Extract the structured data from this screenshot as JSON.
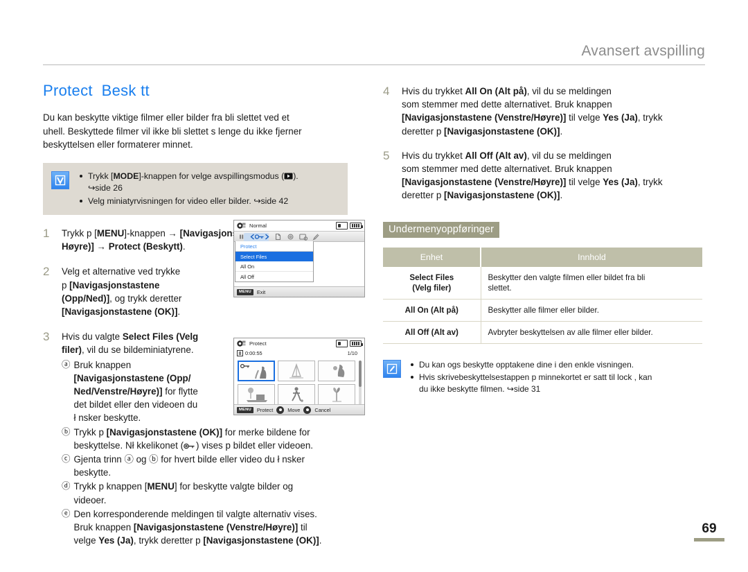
{
  "header": {
    "title": "Avansert avspilling"
  },
  "page": {
    "number": "69"
  },
  "left": {
    "section_title": "Protect  Besk tt",
    "intro": "Du kan beskytte viktige filmer eller bilder fra   bli slettet ved et\nuhell. Beskyttede filmer vil ikke bli slettet s   lenge du ikke fjerner\nbeskyttelsen eller formaterer minnet.",
    "tip_icon": "check-icon",
    "tips": [
      "Trykk [MODE]-knappen for   velge avspillingsmodus (  ).\n↪side 26",
      "Velg miniatyrvisningen for video eller bilder. ↪side 42"
    ],
    "tip1_a": "Trykk [",
    "tip1_mode": "MODE",
    "tip1_b": "]-knappen for   velge avspillingsmodus (",
    "tip1_c": ").",
    "tip1_page": "↪side 26",
    "tip2": "Velg miniatyrvisningen for video eller bilder. ",
    "tip2_page": "↪side 42",
    "steps": [
      {
        "num": "1",
        "parts": [
          {
            "t": "Trykk p  [",
            "b": false
          },
          {
            "t": "MENU",
            "b": true
          },
          {
            "t": "]-knappen → ",
            "b": false
          },
          {
            "t": "[Navigasjonstastene (Venstre/\nHøyre)]",
            "b": true
          },
          {
            "t": " → ",
            "b": false
          },
          {
            "t": "Protect (Beskytt)",
            "b": true
          },
          {
            "t": ".",
            "b": false
          }
        ]
      },
      {
        "num": "2",
        "parts": [
          {
            "t": "Velg et alternative ved   trykke\np  ",
            "b": false
          },
          {
            "t": "[Navigasjonstastene\n(Opp/Ned)]",
            "b": true
          },
          {
            "t": ", og trykk deretter\n",
            "b": false
          },
          {
            "t": "[Navigasjonstastene (OK)]",
            "b": true
          },
          {
            "t": ".",
            "b": false
          }
        ]
      },
      {
        "num": "3",
        "parts": [
          {
            "t": "Hvis du valgte ",
            "b": false
          },
          {
            "t": "Select Files (Velg\nfiler)",
            "b": true
          },
          {
            "t": ", vil du se bildeminiatyrene.",
            "b": false
          }
        ]
      }
    ],
    "substeps": [
      {
        "mark": "ⓐ",
        "parts": [
          {
            "t": "Bruk knappen\n",
            "b": false
          },
          {
            "t": "[Navigasjonstastene (Opp/\nNed/Venstre/Høyre)]",
            "b": true
          },
          {
            "t": " for   flytte\ndet bildet eller den videoen du\nł nsker   beskytte.",
            "b": false
          }
        ]
      },
      {
        "mark": "ⓑ",
        "parts": [
          {
            "t": "Trykk p  ",
            "b": false
          },
          {
            "t": "[Navigasjonstastene (OK)]",
            "b": true
          },
          {
            "t": " for   merke bildene for\nbeskyttelse. Nł kkelikonet (",
            "b": false
          },
          {
            "t": "KEYICON",
            "b": false
          },
          {
            "t": ") vises p   bildet eller videoen.",
            "b": false
          }
        ]
      },
      {
        "mark": "ⓒ",
        "parts": [
          {
            "t": "Gjenta trinn ⓐ og ⓑ for hvert bilde eller video du ł nsker\nbeskytte.",
            "b": false
          }
        ]
      },
      {
        "mark": "ⓓ",
        "parts": [
          {
            "t": "Trykk p   knappen [",
            "b": false
          },
          {
            "t": "MENU",
            "b": true
          },
          {
            "t": "] for   beskytte valgte bilder og\nvideoer.",
            "b": false
          }
        ]
      },
      {
        "mark": "ⓔ",
        "parts": [
          {
            "t": "Den korresponderende meldingen til valgte alternativ vises.\nBruk knappen ",
            "b": false
          },
          {
            "t": "[Navigasjonstastene (Venstre/Høyre)]",
            "b": true
          },
          {
            "t": " til\nvelge ",
            "b": false
          },
          {
            "t": "Yes (Ja)",
            "b": true
          },
          {
            "t": ", trykk deretter p  ",
            "b": false
          },
          {
            "t": "[Navigasjonstastene (OK)]",
            "b": true
          },
          {
            "t": ".",
            "b": false
          }
        ]
      }
    ]
  },
  "right": {
    "steps": [
      {
        "num": "4",
        "parts": [
          {
            "t": "Hvis du trykket ",
            "b": false
          },
          {
            "t": "All On (Alt på)",
            "b": true
          },
          {
            "t": ", vil du se meldingen\nsom stemmer med dette alternativet. Bruk knappen\n",
            "b": false
          },
          {
            "t": "[Navigasjonstastene (Venstre/Høyre)]",
            "b": true
          },
          {
            "t": " til   velge ",
            "b": false
          },
          {
            "t": "Yes (Ja)",
            "b": true
          },
          {
            "t": ", trykk\nderetter p  ",
            "b": false
          },
          {
            "t": "[Navigasjonstastene (OK)]",
            "b": true
          },
          {
            "t": ".",
            "b": false
          }
        ]
      },
      {
        "num": "5",
        "parts": [
          {
            "t": "Hvis du trykket ",
            "b": false
          },
          {
            "t": "All Off (Alt av)",
            "b": true
          },
          {
            "t": ", vil du se meldingen\nsom stemmer med dette alternativet. Bruk knappen\n",
            "b": false
          },
          {
            "t": "[Navigasjonstastene (Venstre/Høyre)]",
            "b": true
          },
          {
            "t": " til   velge ",
            "b": false
          },
          {
            "t": "Yes (Ja)",
            "b": true
          },
          {
            "t": ", trykk\nderetter p  ",
            "b": false
          },
          {
            "t": "[Navigasjonstastene (OK)]",
            "b": true
          },
          {
            "t": ".",
            "b": false
          }
        ]
      }
    ],
    "submenu_heading": "Undermenyoppføringer",
    "table": {
      "columns": [
        "Enhet",
        "Innhold"
      ],
      "rows": [
        {
          "item": "Select Files\n(Velg filer)",
          "content": "Beskytter den valgte filmen eller bildet fra   bli\nslettet."
        },
        {
          "item": "All On (Alt på)",
          "content": "Beskytter alle filmer eller bilder."
        },
        {
          "item": "All Off (Alt av)",
          "content": "Avbryter beskyttelsen av alle filmer eller bilder."
        }
      ]
    },
    "note_icon": "pen-note-icon",
    "notes": [
      "Du kan ogs   beskytte opptakene dine i den enkle visningen.",
      "Hvis skrivebeskyttelsestappen p   minnekortet er satt til  lock , kan\ndu ikke beskytte filmen. ↪side 31"
    ]
  },
  "lcd1": {
    "title": "Normal",
    "menu_header": "Protect",
    "items": [
      "Select Files",
      "All On",
      "All Off"
    ],
    "selected_index": 0,
    "menu_badge": "MENU",
    "bottom_label": "Exit"
  },
  "lcd2": {
    "title": "Protect",
    "time": "0:00:55",
    "counter": "1/10",
    "menu_badge": "MENU",
    "bottom_labels": [
      "Protect",
      "Move",
      "Cancel"
    ]
  },
  "colors": {
    "accent_blue": "#1a7fee",
    "tip_bg": "#dedad2",
    "table_header": "#bfbfa9",
    "heading_badge": "#9d9d84",
    "step_num": "#9a9a86"
  }
}
